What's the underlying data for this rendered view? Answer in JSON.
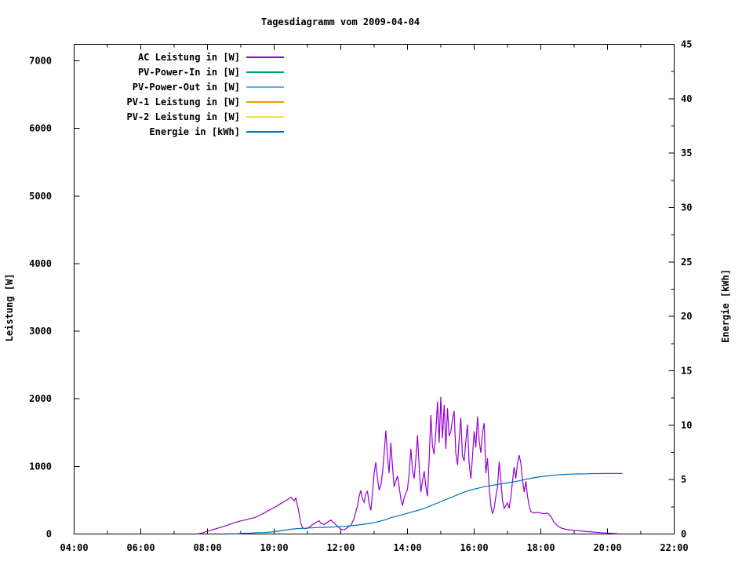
{
  "title": "Tagesdiagramm vom 2009-04-04",
  "chart_data": {
    "type": "line",
    "title": "Tagesdiagramm vom 2009-04-04",
    "grid": false,
    "legend_position": "top-left-inside",
    "x_axis": {
      "range": [
        4,
        22
      ],
      "minor_step": 1,
      "tick_values": [
        4,
        6,
        8,
        10,
        12,
        14,
        16,
        18,
        20,
        22
      ],
      "tick_labels": [
        "04:00",
        "06:00",
        "08:00",
        "10:00",
        "12:00",
        "14:00",
        "16:00",
        "18:00",
        "20:00",
        "22:00"
      ]
    },
    "y_left": {
      "label": "Leistung [W]",
      "range": [
        0,
        7244
      ],
      "tick_values": [
        0,
        1000,
        2000,
        3000,
        4000,
        5000,
        6000,
        7000
      ],
      "tick_labels": [
        "0",
        "1000",
        "2000",
        "3000",
        "4000",
        "5000",
        "6000",
        "7000"
      ]
    },
    "y_right": {
      "label": "Energie [kWh]",
      "range": [
        0,
        45
      ],
      "minor_step": 2.5,
      "tick_values": [
        0,
        5,
        10,
        15,
        20,
        25,
        30,
        35,
        40,
        45
      ],
      "tick_labels": [
        "0",
        "5",
        "10",
        "15",
        "20",
        "25",
        "30",
        "35",
        "40",
        "45"
      ]
    },
    "series": [
      {
        "name": "AC Leistung in [W]",
        "color": "#9400d3",
        "axis": "left",
        "points": [
          [
            7.7,
            0
          ],
          [
            7.8,
            10
          ],
          [
            7.9,
            25
          ],
          [
            8.0,
            40
          ],
          [
            8.1,
            55
          ],
          [
            8.2,
            70
          ],
          [
            8.3,
            85
          ],
          [
            8.4,
            100
          ],
          [
            8.5,
            115
          ],
          [
            8.6,
            130
          ],
          [
            8.7,
            150
          ],
          [
            8.8,
            165
          ],
          [
            8.9,
            180
          ],
          [
            9.0,
            195
          ],
          [
            9.1,
            205
          ],
          [
            9.2,
            215
          ],
          [
            9.25,
            225
          ],
          [
            9.3,
            230
          ],
          [
            9.4,
            240
          ],
          [
            9.5,
            260
          ],
          [
            9.6,
            285
          ],
          [
            9.7,
            310
          ],
          [
            9.8,
            340
          ],
          [
            9.9,
            365
          ],
          [
            10.0,
            390
          ],
          [
            10.1,
            420
          ],
          [
            10.2,
            450
          ],
          [
            10.3,
            480
          ],
          [
            10.4,
            510
          ],
          [
            10.5,
            545
          ],
          [
            10.55,
            520
          ],
          [
            10.6,
            490
          ],
          [
            10.65,
            535
          ],
          [
            10.7,
            430
          ],
          [
            10.75,
            300
          ],
          [
            10.8,
            160
          ],
          [
            10.85,
            95
          ],
          [
            10.9,
            80
          ],
          [
            11.0,
            85
          ],
          [
            11.1,
            120
          ],
          [
            11.2,
            155
          ],
          [
            11.3,
            185
          ],
          [
            11.35,
            195
          ],
          [
            11.4,
            160
          ],
          [
            11.5,
            140
          ],
          [
            11.6,
            175
          ],
          [
            11.7,
            205
          ],
          [
            11.8,
            160
          ],
          [
            11.9,
            115
          ],
          [
            12.0,
            70
          ],
          [
            12.1,
            60
          ],
          [
            12.2,
            95
          ],
          [
            12.3,
            130
          ],
          [
            12.4,
            230
          ],
          [
            12.5,
            420
          ],
          [
            12.55,
            560
          ],
          [
            12.6,
            645
          ],
          [
            12.65,
            520
          ],
          [
            12.7,
            470
          ],
          [
            12.75,
            600
          ],
          [
            12.8,
            630
          ],
          [
            12.85,
            450
          ],
          [
            12.9,
            350
          ],
          [
            12.95,
            600
          ],
          [
            13.0,
            900
          ],
          [
            13.05,
            1060
          ],
          [
            13.1,
            820
          ],
          [
            13.15,
            650
          ],
          [
            13.2,
            720
          ],
          [
            13.25,
            900
          ],
          [
            13.3,
            1200
          ],
          [
            13.35,
            1530
          ],
          [
            13.4,
            1150
          ],
          [
            13.45,
            900
          ],
          [
            13.5,
            1350
          ],
          [
            13.55,
            1000
          ],
          [
            13.6,
            700
          ],
          [
            13.65,
            780
          ],
          [
            13.7,
            860
          ],
          [
            13.75,
            700
          ],
          [
            13.8,
            520
          ],
          [
            13.85,
            420
          ],
          [
            13.9,
            540
          ],
          [
            13.95,
            600
          ],
          [
            14.0,
            660
          ],
          [
            14.05,
            900
          ],
          [
            14.1,
            1260
          ],
          [
            14.15,
            950
          ],
          [
            14.2,
            820
          ],
          [
            14.25,
            1100
          ],
          [
            14.3,
            1460
          ],
          [
            14.35,
            1000
          ],
          [
            14.4,
            620
          ],
          [
            14.45,
            780
          ],
          [
            14.5,
            930
          ],
          [
            14.55,
            700
          ],
          [
            14.6,
            560
          ],
          [
            14.65,
            1100
          ],
          [
            14.7,
            1760
          ],
          [
            14.75,
            1300
          ],
          [
            14.8,
            1180
          ],
          [
            14.85,
            1500
          ],
          [
            14.9,
            1960
          ],
          [
            14.95,
            1350
          ],
          [
            15.0,
            2030
          ],
          [
            15.05,
            1420
          ],
          [
            15.1,
            1910
          ],
          [
            15.15,
            1260
          ],
          [
            15.2,
            1860
          ],
          [
            15.25,
            1450
          ],
          [
            15.3,
            1520
          ],
          [
            15.35,
            1700
          ],
          [
            15.4,
            1820
          ],
          [
            15.45,
            1200
          ],
          [
            15.5,
            1020
          ],
          [
            15.55,
            1400
          ],
          [
            15.6,
            1720
          ],
          [
            15.65,
            1150
          ],
          [
            15.7,
            1080
          ],
          [
            15.75,
            1380
          ],
          [
            15.8,
            1620
          ],
          [
            15.85,
            1050
          ],
          [
            15.9,
            820
          ],
          [
            15.95,
            1150
          ],
          [
            16.0,
            1520
          ],
          [
            16.05,
            1280
          ],
          [
            16.1,
            1740
          ],
          [
            16.15,
            1380
          ],
          [
            16.2,
            1200
          ],
          [
            16.25,
            1500
          ],
          [
            16.3,
            1640
          ],
          [
            16.35,
            900
          ],
          [
            16.4,
            1120
          ],
          [
            16.45,
            700
          ],
          [
            16.5,
            420
          ],
          [
            16.55,
            300
          ],
          [
            16.6,
            380
          ],
          [
            16.65,
            550
          ],
          [
            16.7,
            700
          ],
          [
            16.75,
            1070
          ],
          [
            16.8,
            800
          ],
          [
            16.85,
            500
          ],
          [
            16.9,
            380
          ],
          [
            16.95,
            420
          ],
          [
            17.0,
            460
          ],
          [
            17.05,
            380
          ],
          [
            17.1,
            550
          ],
          [
            17.15,
            780
          ],
          [
            17.2,
            990
          ],
          [
            17.25,
            820
          ],
          [
            17.3,
            1050
          ],
          [
            17.35,
            1165
          ],
          [
            17.4,
            1050
          ],
          [
            17.45,
            800
          ],
          [
            17.5,
            620
          ],
          [
            17.55,
            780
          ],
          [
            17.6,
            560
          ],
          [
            17.65,
            420
          ],
          [
            17.7,
            330
          ],
          [
            17.8,
            310
          ],
          [
            17.9,
            320
          ],
          [
            18.0,
            310
          ],
          [
            18.1,
            300
          ],
          [
            18.2,
            310
          ],
          [
            18.3,
            260
          ],
          [
            18.4,
            170
          ],
          [
            18.5,
            120
          ],
          [
            18.6,
            90
          ],
          [
            18.7,
            75
          ],
          [
            18.8,
            65
          ],
          [
            19.0,
            55
          ],
          [
            19.2,
            45
          ],
          [
            19.4,
            35
          ],
          [
            19.6,
            28
          ],
          [
            19.8,
            20
          ],
          [
            20.0,
            14
          ],
          [
            20.2,
            8
          ],
          [
            20.3,
            5
          ]
        ]
      },
      {
        "name": "PV-Power-In in [W]",
        "color": "#009e73",
        "axis": "left",
        "points": []
      },
      {
        "name": "PV-Power-Out in [W]",
        "color": "#56b4e9",
        "axis": "left",
        "points": []
      },
      {
        "name": "PV-1 Leistung in [W]",
        "color": "#e69f00",
        "axis": "left",
        "points": []
      },
      {
        "name": "PV-2 Leistung in [W]",
        "color": "#f0e442",
        "axis": "left",
        "points": []
      },
      {
        "name": "Energie in [kWh]",
        "color": "#0072b2",
        "axis": "right",
        "points": [
          [
            8.6,
            0.02
          ],
          [
            8.9,
            0.03
          ],
          [
            9.1,
            0.07
          ],
          [
            9.3,
            0.08
          ],
          [
            9.5,
            0.12
          ],
          [
            9.7,
            0.13
          ],
          [
            9.9,
            0.18
          ],
          [
            10.1,
            0.25
          ],
          [
            10.3,
            0.35
          ],
          [
            10.5,
            0.44
          ],
          [
            10.7,
            0.5
          ],
          [
            10.9,
            0.53
          ],
          [
            11.1,
            0.56
          ],
          [
            11.3,
            0.59
          ],
          [
            11.5,
            0.61
          ],
          [
            11.7,
            0.64
          ],
          [
            11.9,
            0.67
          ],
          [
            12.1,
            0.71
          ],
          [
            12.3,
            0.76
          ],
          [
            12.5,
            0.82
          ],
          [
            12.7,
            0.9
          ],
          [
            12.9,
            0.98
          ],
          [
            13.1,
            1.12
          ],
          [
            13.3,
            1.28
          ],
          [
            13.5,
            1.5
          ],
          [
            13.7,
            1.65
          ],
          [
            13.9,
            1.82
          ],
          [
            14.1,
            2.0
          ],
          [
            14.3,
            2.16
          ],
          [
            14.5,
            2.35
          ],
          [
            14.7,
            2.6
          ],
          [
            14.9,
            2.85
          ],
          [
            15.1,
            3.1
          ],
          [
            15.3,
            3.35
          ],
          [
            15.5,
            3.6
          ],
          [
            15.7,
            3.85
          ],
          [
            15.9,
            4.05
          ],
          [
            16.1,
            4.2
          ],
          [
            16.3,
            4.35
          ],
          [
            16.5,
            4.45
          ],
          [
            16.7,
            4.55
          ],
          [
            16.9,
            4.65
          ],
          [
            17.1,
            4.75
          ],
          [
            17.3,
            4.85
          ],
          [
            17.5,
            5.0
          ],
          [
            17.7,
            5.12
          ],
          [
            17.9,
            5.22
          ],
          [
            18.1,
            5.3
          ],
          [
            18.3,
            5.38
          ],
          [
            18.5,
            5.43
          ],
          [
            18.7,
            5.47
          ],
          [
            18.9,
            5.5
          ],
          [
            19.1,
            5.52
          ],
          [
            19.3,
            5.53
          ],
          [
            19.6,
            5.55
          ],
          [
            20.0,
            5.56
          ],
          [
            20.45,
            5.56
          ]
        ]
      }
    ]
  }
}
